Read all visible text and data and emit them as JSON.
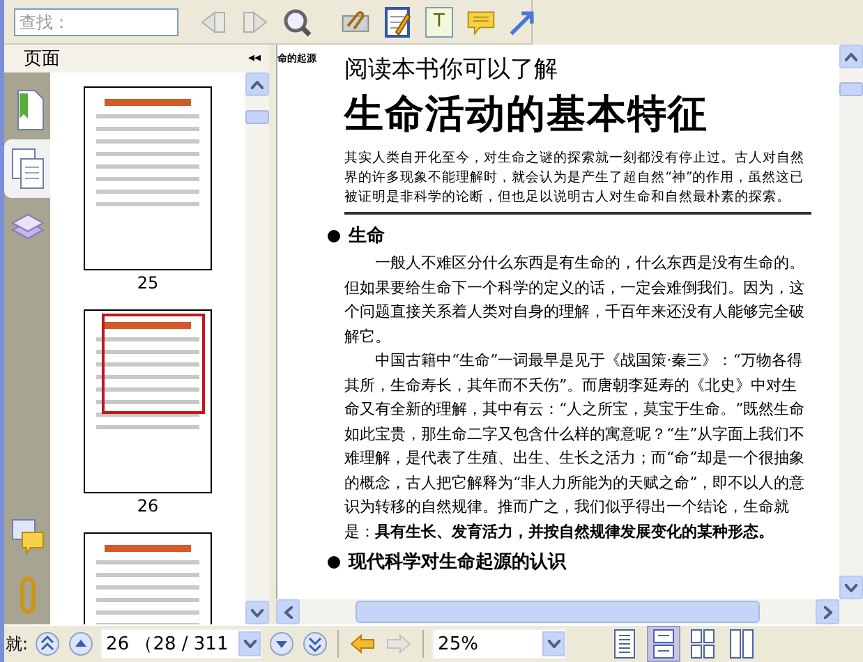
{
  "toolbar": {
    "search": {
      "placeholder": "查找："
    },
    "find_buttons": [
      {
        "kind": "prev",
        "disabled": true
      },
      {
        "kind": "next",
        "disabled": true
      },
      {
        "kind": "magnifier",
        "disabled": false
      }
    ],
    "tools": [
      {
        "kind": "paperclip"
      },
      {
        "kind": "notepad"
      },
      {
        "kind": "textbox",
        "glyph": "T"
      },
      {
        "kind": "comment"
      },
      {
        "kind": "arrow"
      }
    ]
  },
  "side_panel": {
    "title": "页面",
    "collapse": "◂◂",
    "tabs": [
      {
        "kind": "bookmarks",
        "selected": false
      },
      {
        "kind": "pages",
        "selected": true
      },
      {
        "kind": "layers",
        "selected": false
      }
    ],
    "bottom_tabs": [
      {
        "kind": "comments"
      },
      {
        "kind": "attachments"
      }
    ],
    "thumbnails": [
      {
        "label": "25",
        "selected": false
      },
      {
        "label": "26",
        "selected": true
      },
      {
        "selected": false
      }
    ]
  },
  "document": {
    "running_head": "命的起源",
    "subtitle": "阅读本书你可以了解",
    "title": "生命活动的基本特征",
    "intro": "其实人类自开化至今，对生命之谜的探索就一刻都没有停止过。古人对自然界的许多现象不能理解时，就会认为是产生了超自然“神”的作用，虽然这已被证明是非科学的论断，但也足以说明古人对生命和自然最朴素的探索。",
    "sections": [
      {
        "heading": "生命",
        "paragraphs": [
          "一般人不难区分什么东西是有生命的，什么东西是没有生命的。但如果要给生命下一个科学的定义的话，一定会难倒我们。因为，这个问题直接关系着人类对自身的理解，千百年来还没有人能够完全破解它。",
          "中国古籍中“生命”一词最早是见于《战国策·秦三》：“万物各得其所，生命寿长，其年而不夭伤”。而唐朝李延寿的《北史》中对生命又有全新的理解，其中有云：“人之所宝，莫宝于生命。”既然生命如此宝贵，那生命二字又包含什么样的寓意呢？“生”从字面上我们不难理解，是代表了生殖、出生、生长之活力；而“命”却是一个很抽象的概念，古人把它解释为“非人力所能为的天赋之命”，即不以人的意识为转移的自然规律。推而广之，我们似乎得出一个结论，生命就是：**具有生长、发育活力，并按自然规律发展变化的某种形态。**"
        ]
      },
      {
        "heading": "现代科学对生命起源的认识"
      }
    ]
  },
  "status_bar": {
    "label": "就:",
    "page_field": "26 （28 / 311",
    "nav": [
      {
        "kind": "first",
        "disabled": false
      },
      {
        "kind": "prev",
        "disabled": false
      },
      {
        "kind": "next",
        "disabled": false
      },
      {
        "kind": "last",
        "disabled": false
      }
    ],
    "history": [
      {
        "kind": "back",
        "disabled": false
      },
      {
        "kind": "forward",
        "disabled": true
      }
    ],
    "zoom": "25%",
    "views": [
      {
        "kind": "single",
        "selected": false
      },
      {
        "kind": "continuous",
        "selected": true
      },
      {
        "kind": "facing-continuous",
        "selected": false
      },
      {
        "kind": "facing",
        "selected": false
      }
    ]
  }
}
